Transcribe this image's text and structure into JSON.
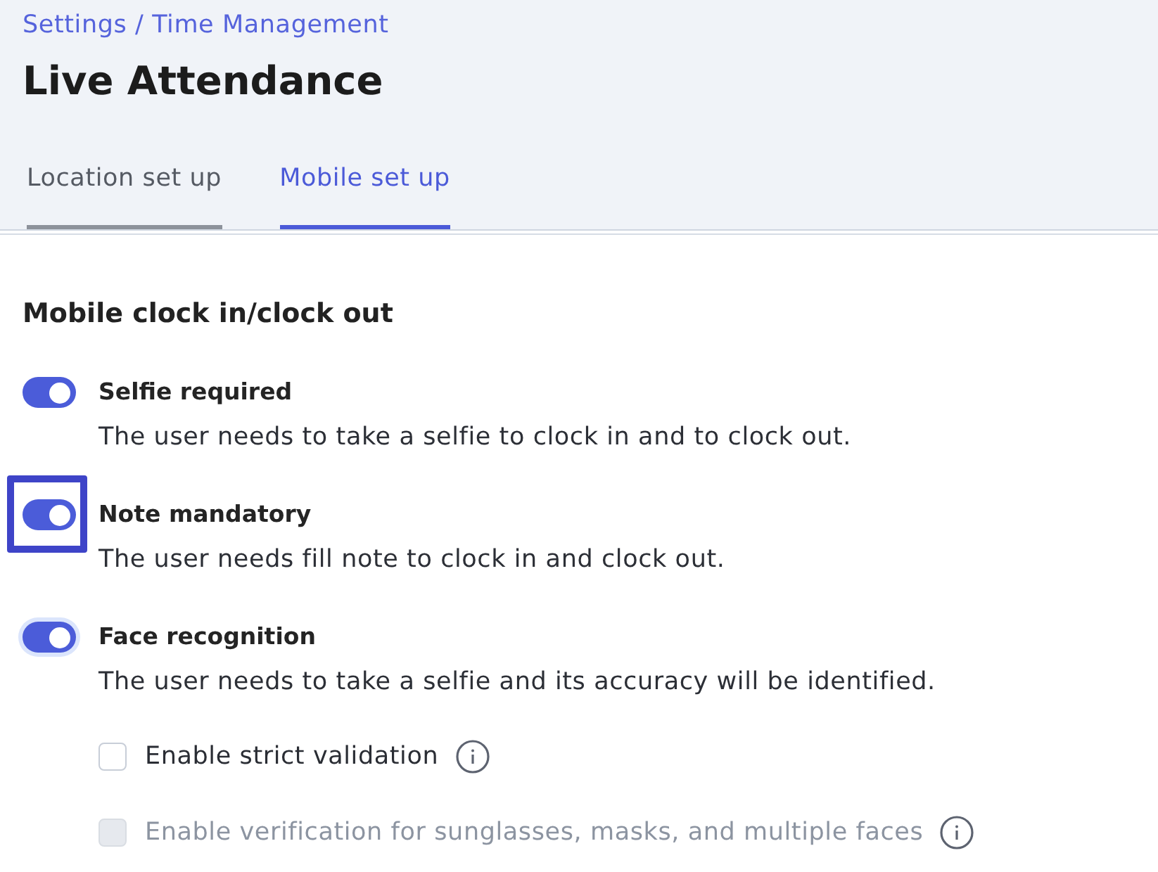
{
  "breadcrumb": "Settings / Time Management",
  "title": "Live Attendance",
  "tabs": [
    {
      "label": "Location set up",
      "selected": false
    },
    {
      "label": "Mobile set up",
      "selected": true
    }
  ],
  "section": {
    "heading": "Mobile clock in/clock out",
    "toggles": [
      {
        "title": "Selfie required",
        "description": "The user needs to take a selfie to clock in and to clock out.",
        "on": true,
        "focused": false,
        "highlighted": false
      },
      {
        "title": "Note mandatory",
        "description": "The user needs fill note to clock in and clock out.",
        "on": true,
        "focused": false,
        "highlighted": true
      },
      {
        "title": "Face recognition",
        "description": "The user needs to take a selfie and its accuracy will be identified.",
        "on": true,
        "focused": true,
        "highlighted": false
      }
    ],
    "options": [
      {
        "label": "Enable strict validation",
        "checked": false,
        "disabled": false,
        "info": true
      },
      {
        "label": "Enable verification for sunglasses, masks, and multiple faces",
        "checked": false,
        "disabled": true,
        "info": true
      }
    ]
  }
}
